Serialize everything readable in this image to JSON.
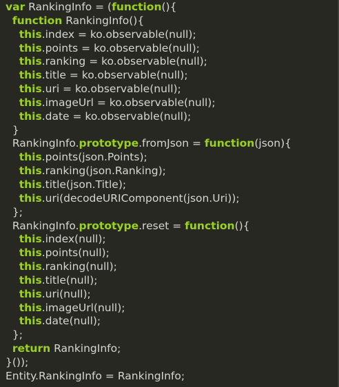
{
  "colors": {
    "background": "#272822",
    "text": "#d6d6d2",
    "keyword": "#9bd21e"
  },
  "code": {
    "lines": [
      {
        "indent": "",
        "tokens": [
          {
            "t": "var",
            "k": true
          },
          {
            "t": " RankingInfo = (",
            "k": false
          },
          {
            "t": "function",
            "k": true
          },
          {
            "t": "(){",
            "k": false
          }
        ]
      },
      {
        "indent": "  ",
        "tokens": [
          {
            "t": "function",
            "k": true
          },
          {
            "t": " RankingInfo(){",
            "k": false
          }
        ]
      },
      {
        "indent": "    ",
        "tokens": [
          {
            "t": "this",
            "k": true
          },
          {
            "t": ".index = ko.observable(null);",
            "k": false
          }
        ]
      },
      {
        "indent": "    ",
        "tokens": [
          {
            "t": "this",
            "k": true
          },
          {
            "t": ".points = ko.observable(null);",
            "k": false
          }
        ]
      },
      {
        "indent": "    ",
        "tokens": [
          {
            "t": "this",
            "k": true
          },
          {
            "t": ".ranking = ko.observable(null);",
            "k": false
          }
        ]
      },
      {
        "indent": "    ",
        "tokens": [
          {
            "t": "this",
            "k": true
          },
          {
            "t": ".title = ko.observable(null);",
            "k": false
          }
        ]
      },
      {
        "indent": "    ",
        "tokens": [
          {
            "t": "this",
            "k": true
          },
          {
            "t": ".uri = ko.observable(null);",
            "k": false
          }
        ]
      },
      {
        "indent": "    ",
        "tokens": [
          {
            "t": "this",
            "k": true
          },
          {
            "t": ".imageUrl = ko.observable(null);",
            "k": false
          }
        ]
      },
      {
        "indent": "    ",
        "tokens": [
          {
            "t": "this",
            "k": true
          },
          {
            "t": ".date = ko.observable(null);",
            "k": false
          }
        ]
      },
      {
        "indent": "  ",
        "tokens": [
          {
            "t": "}",
            "k": false
          }
        ]
      },
      {
        "indent": "  ",
        "tokens": [
          {
            "t": "RankingInfo.",
            "k": false
          },
          {
            "t": "prototype",
            "k": true
          },
          {
            "t": ".fromJson = ",
            "k": false
          },
          {
            "t": "function",
            "k": true
          },
          {
            "t": "(json){",
            "k": false
          }
        ]
      },
      {
        "indent": "    ",
        "tokens": [
          {
            "t": "this",
            "k": true
          },
          {
            "t": ".points(json.Points);",
            "k": false
          }
        ]
      },
      {
        "indent": "    ",
        "tokens": [
          {
            "t": "this",
            "k": true
          },
          {
            "t": ".ranking(json.Ranking);",
            "k": false
          }
        ]
      },
      {
        "indent": "    ",
        "tokens": [
          {
            "t": "this",
            "k": true
          },
          {
            "t": ".title(json.Title);",
            "k": false
          }
        ]
      },
      {
        "indent": "    ",
        "tokens": [
          {
            "t": "this",
            "k": true
          },
          {
            "t": ".uri(decodeURIComponent(json.Uri));",
            "k": false
          }
        ]
      },
      {
        "indent": "  ",
        "tokens": [
          {
            "t": "};",
            "k": false
          }
        ]
      },
      {
        "indent": "  ",
        "tokens": [
          {
            "t": "RankingInfo.",
            "k": false
          },
          {
            "t": "prototype",
            "k": true
          },
          {
            "t": ".reset = ",
            "k": false
          },
          {
            "t": "function",
            "k": true
          },
          {
            "t": "(){",
            "k": false
          }
        ]
      },
      {
        "indent": "    ",
        "tokens": [
          {
            "t": "this",
            "k": true
          },
          {
            "t": ".index(null);",
            "k": false
          }
        ]
      },
      {
        "indent": "    ",
        "tokens": [
          {
            "t": "this",
            "k": true
          },
          {
            "t": ".points(null);",
            "k": false
          }
        ]
      },
      {
        "indent": "    ",
        "tokens": [
          {
            "t": "this",
            "k": true
          },
          {
            "t": ".ranking(null);",
            "k": false
          }
        ]
      },
      {
        "indent": "    ",
        "tokens": [
          {
            "t": "this",
            "k": true
          },
          {
            "t": ".title(null);",
            "k": false
          }
        ]
      },
      {
        "indent": "    ",
        "tokens": [
          {
            "t": "this",
            "k": true
          },
          {
            "t": ".uri(null);",
            "k": false
          }
        ]
      },
      {
        "indent": "    ",
        "tokens": [
          {
            "t": "this",
            "k": true
          },
          {
            "t": ".imageUrl(null);",
            "k": false
          }
        ]
      },
      {
        "indent": "    ",
        "tokens": [
          {
            "t": "this",
            "k": true
          },
          {
            "t": ".date(null);",
            "k": false
          }
        ]
      },
      {
        "indent": "  ",
        "tokens": [
          {
            "t": "};",
            "k": false
          }
        ]
      },
      {
        "indent": "  ",
        "tokens": [
          {
            "t": "return",
            "k": true
          },
          {
            "t": " RankingInfo;",
            "k": false
          }
        ]
      },
      {
        "indent": "",
        "tokens": [
          {
            "t": "}());",
            "k": false
          }
        ]
      },
      {
        "indent": "",
        "tokens": [
          {
            "t": "Entity.RankingInfo = RankingInfo;",
            "k": false
          }
        ]
      }
    ]
  }
}
